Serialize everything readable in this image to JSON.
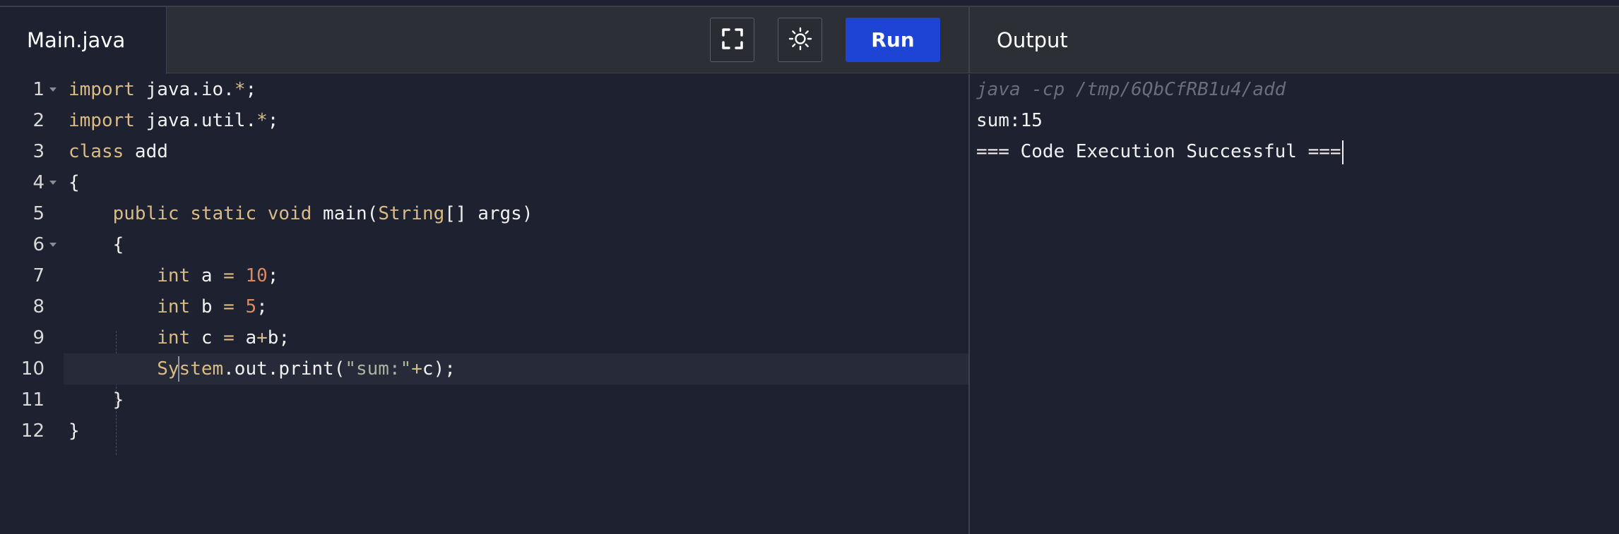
{
  "editor": {
    "file_tab": "Main.java",
    "run_label": "Run",
    "fullscreen_icon": "fullscreen-icon",
    "theme_icon": "sun-icon",
    "line_numbers": [
      "1",
      "2",
      "3",
      "4",
      "5",
      "6",
      "7",
      "8",
      "9",
      "10",
      "11",
      "12"
    ],
    "lines": {
      "l1": {
        "kw": "import",
        "rest1": " java.io.",
        "op": "*",
        "rest2": ";"
      },
      "l2": {
        "kw": "import",
        "rest1": " java.util.",
        "op": "*",
        "rest2": ";"
      },
      "l3": {
        "kw": "class",
        "rest": " add"
      },
      "l4": {
        "text": "{"
      },
      "l5": {
        "indent": "    ",
        "kw1": "public",
        "sp1": " ",
        "kw2": "static",
        "sp2": " ",
        "kw3": "void",
        "rest1": " main(",
        "cls": "String",
        "rest2": "[] args)"
      },
      "l6": {
        "text": "    {"
      },
      "l7": {
        "indent": "        ",
        "kw": "int",
        "rest1": " a ",
        "op": "=",
        "sp": " ",
        "num": "10",
        "rest2": ";"
      },
      "l8": {
        "indent": "        ",
        "kw": "int",
        "rest1": " b ",
        "op": "=",
        "sp": " ",
        "num": "5",
        "rest2": ";"
      },
      "l9": {
        "indent": "        ",
        "kw": "int",
        "rest1": " c ",
        "op": "=",
        "rest2": " a",
        "op2": "+",
        "rest3": "b;"
      },
      "l10": {
        "indent": "        ",
        "cls": "System",
        "rest1": ".out.print(",
        "str": "\"sum:\"",
        "op": "+",
        "rest2": "c);"
      },
      "l11": {
        "text": "    }"
      },
      "l12": {
        "text": "}"
      }
    }
  },
  "output": {
    "title": "Output",
    "command": "java -cp /tmp/6QbCfRB1u4/add",
    "result": "sum:15",
    "status": "=== Code Execution Successful ==="
  }
}
